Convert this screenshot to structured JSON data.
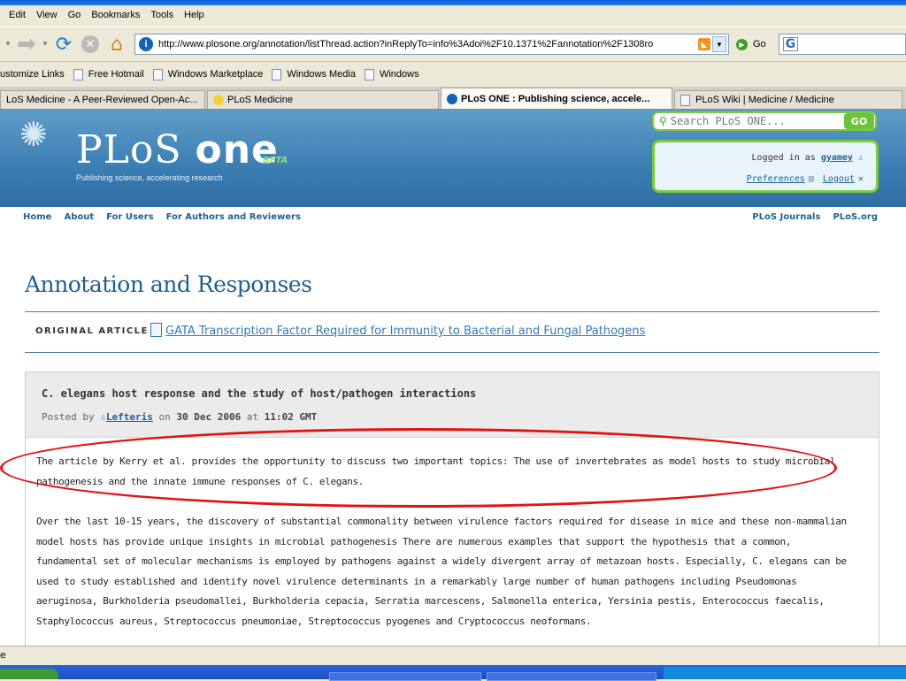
{
  "browser": {
    "menu": [
      "Edit",
      "View",
      "Go",
      "Bookmarks",
      "Tools",
      "Help"
    ],
    "url": "http://www.plosone.org/annotation/listThread.action?inReplyTo=info%3Adoi%2F10.1371%2Fannotation%2F1308ro",
    "go_label": "Go",
    "google_label": "G",
    "links": [
      "ustomize Links",
      "Free Hotmail",
      "Windows Marketplace",
      "Windows Media",
      "Windows"
    ],
    "tabs": [
      {
        "label": "LoS Medicine - A Peer-Reviewed Open-Ac..."
      },
      {
        "label": "PLoS Medicine"
      },
      {
        "label": "PLoS ONE : Publishing science, accele..."
      },
      {
        "label": "PLoS Wiki | Medicine / Medicine"
      }
    ],
    "status": "e"
  },
  "site": {
    "logo_plos": "PLoS",
    "logo_one": "one",
    "logo_beta": "BETA",
    "tagline": "Publishing science, accelerating research",
    "search_placeholder": "Search PLoS ONE...",
    "search_go": "GO",
    "logged_in_as": "Logged in as",
    "username": "gyamey",
    "preferences": "Preferences",
    "logout": "Logout",
    "nav_left": [
      "Home",
      "About",
      "For Users",
      "For Authors and Reviewers"
    ],
    "nav_right": [
      "PLoS Journals",
      "PLoS.org"
    ]
  },
  "content": {
    "page_title": "Annotation and Responses",
    "original_label": "ORIGINAL ARTICLE",
    "original_link": "GATA Transcription Factor Required for Immunity to Bacterial and Fungal Pathogens",
    "thread_title": "C. elegans host response and the study of host/pathogen interactions",
    "posted_by": "Posted by",
    "author": "Lefteris",
    "posted_on": "on",
    "date": "30 Dec 2006",
    "posted_at": "at",
    "time": "11:02 GMT",
    "para1_line1": "The article by Kerry et al. provides the opportunity to discuss two important topics: The use of invertebrates as model hosts to study microbial",
    "para1_line2": "pathogenesis and the innate immune responses of C. elegans.",
    "para2_lines": [
      "Over the last 10-15 years, the discovery of substantial commonality between virulence factors required for disease in mice and these non-mammalian",
      "model hosts has provide unique insights in microbial pathogenesis There are numerous examples that support the hypothesis that a common,",
      "fundamental set of molecular mechanisms is employed by pathogens against a widely divergent array of metazoan hosts. Especially, C. elegans can be",
      "used to study established and identify novel virulence determinants in a remarkably large number of human pathogens including Pseudomonas",
      "aeruginosa, Burkholderia pseudomallei, Burkholderia cepacia, Serratia marcescens, Salmonella enterica, Yersinia pestis, Enterococcus faecalis,",
      "Staphylococcus aureus, Streptococcus pneumoniae, Streptococcus pyogenes and Cryptococcus neoformans."
    ]
  },
  "colors": {
    "accent": "#1e5f99",
    "banner": "#3b7eb3",
    "highlight": "#e31313",
    "green": "#7ccb3a"
  }
}
